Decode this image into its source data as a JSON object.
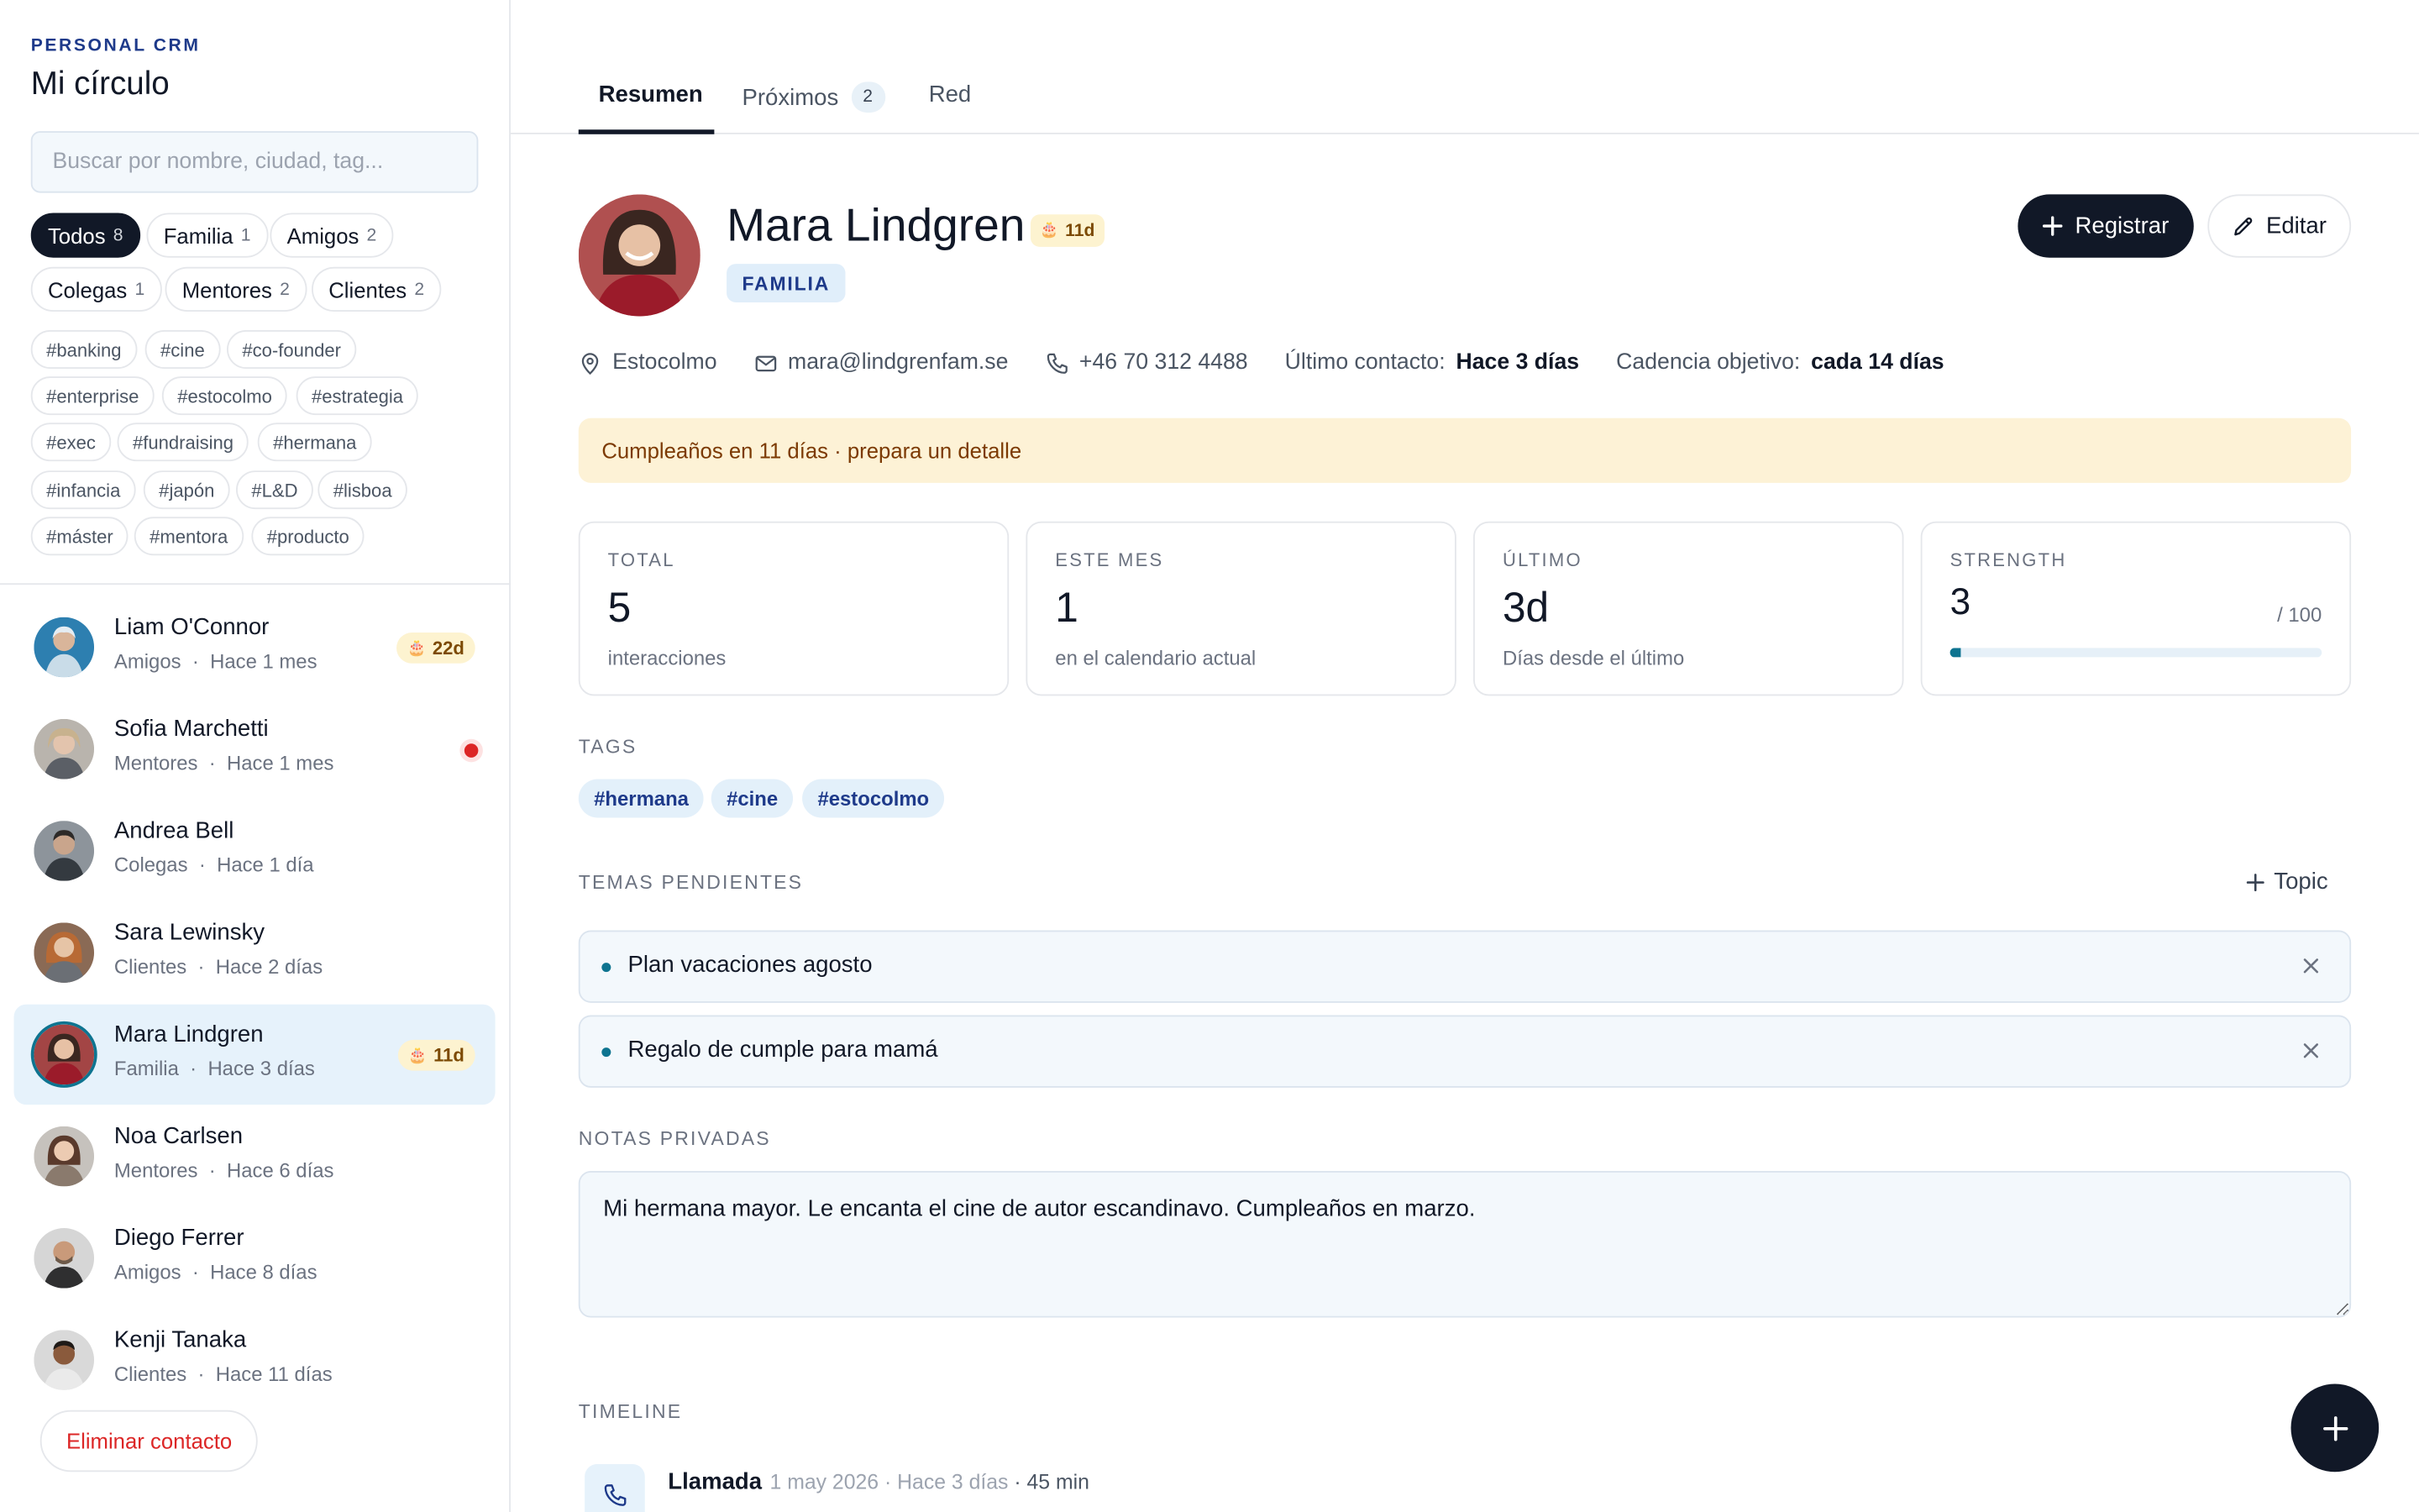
{
  "sidebar": {
    "brand_sub": "PERSONAL CRM",
    "brand_title": "Mi círculo",
    "search_placeholder": "Buscar por nombre, ciudad, tag...",
    "filters": [
      {
        "label": "Todos",
        "count": "8"
      },
      {
        "label": "Familia",
        "count": "1"
      },
      {
        "label": "Amigos",
        "count": "2"
      },
      {
        "label": "Colegas",
        "count": "1"
      },
      {
        "label": "Mentores",
        "count": "2"
      },
      {
        "label": "Clientes",
        "count": "2"
      }
    ],
    "tags": [
      "#banking",
      "#cine",
      "#co-founder",
      "#enterprise",
      "#estocolmo",
      "#estrategia",
      "#exec",
      "#fundraising",
      "#hermana",
      "#infancia",
      "#japón",
      "#L&D",
      "#lisboa",
      "#máster",
      "#mentora",
      "#producto"
    ],
    "contacts": [
      {
        "name": "Liam O'Connor",
        "group": "Amigos",
        "last": "Hace 1 mes",
        "badge": "22d"
      },
      {
        "name": "Sofia Marchetti",
        "group": "Mentores",
        "last": "Hace 1 mes"
      },
      {
        "name": "Andrea Bell",
        "group": "Colegas",
        "last": "Hace 1 día"
      },
      {
        "name": "Sara Lewinsky",
        "group": "Clientes",
        "last": "Hace 2 días"
      },
      {
        "name": "Mara Lindgren",
        "group": "Familia",
        "last": "Hace 3 días",
        "badge": "11d"
      },
      {
        "name": "Noa Carlsen",
        "group": "Mentores",
        "last": "Hace 6 días"
      },
      {
        "name": "Diego Ferrer",
        "group": "Amigos",
        "last": "Hace 8 días"
      },
      {
        "name": "Kenji Tanaka",
        "group": "Clientes",
        "last": "Hace 11 días"
      }
    ],
    "separator": "·",
    "delete_label": "Eliminar contacto"
  },
  "tabs": [
    {
      "label": "Resumen"
    },
    {
      "label": "Próximos",
      "count": "2"
    },
    {
      "label": "Red"
    }
  ],
  "profile": {
    "name": "Mara Lindgren",
    "birthday_badge": "11d",
    "group": "FAMILIA",
    "register_label": "Registrar",
    "edit_label": "Editar",
    "city": "Estocolmo",
    "email": "mara@lindgrenfam.se",
    "phone": "+46 70 312 4488",
    "last_contact_label": "Último contacto:",
    "last_contact_value": "Hace 3 días",
    "cadence_label": "Cadencia objetivo:",
    "cadence_value": "cada 14 días",
    "alert": "Cumpleaños en 11 días · prepara un detalle"
  },
  "stats": [
    {
      "label": "TOTAL",
      "value": "5",
      "sub": "interacciones"
    },
    {
      "label": "ESTE MES",
      "value": "1",
      "sub": "en el calendario actual"
    },
    {
      "label": "ÚLTIMO",
      "value": "3d",
      "sub": "Días desde el último"
    },
    {
      "label": "STRENGTH",
      "value": "3",
      "max": "/ 100",
      "fraction": 0.03
    }
  ],
  "tags_section": {
    "label": "TAGS",
    "tags": [
      "#hermana",
      "#cine",
      "#estocolmo"
    ]
  },
  "topics": {
    "label": "TEMAS PENDIENTES",
    "add_label": "Topic",
    "items": [
      "Plan vacaciones agosto",
      "Regalo de cumple para mamá"
    ]
  },
  "notes": {
    "label": "NOTAS PRIVADAS",
    "text": "Mi hermana mayor. Le encanta el cine de autor escandinavo. Cumpleaños en marzo."
  },
  "timeline": {
    "label": "TIMELINE",
    "entries": [
      {
        "title": "Llamada",
        "date": "1 may 2026 · Hace 3 días",
        "duration": "· 45 min"
      }
    ]
  },
  "colors": {
    "accent": "#0e7490",
    "dark": "#111827",
    "birthday_bg": "#fdf3d0",
    "alert_bg": "#fdf2d6",
    "danger": "#dc2626"
  },
  "icons": [
    "map-pin-icon",
    "mail-icon",
    "phone-icon",
    "plus-icon",
    "pencil-icon",
    "cake-icon",
    "close-icon"
  ]
}
